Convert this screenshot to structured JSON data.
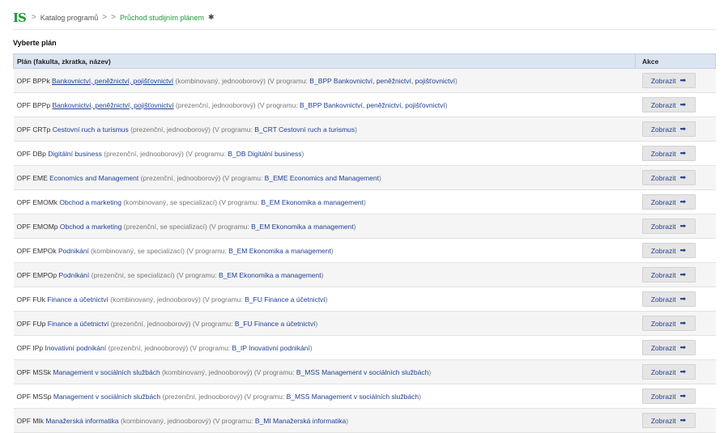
{
  "breadcrumb": {
    "logo": "IS",
    "sep": ">",
    "katalog": "Katalog programů",
    "current": "Průchod studijním plánem",
    "pin": "✱"
  },
  "heading": "Vyberte plán",
  "table": {
    "col_plan": "Plán (fakulta, zkratka, název)",
    "col_akce": "Akce",
    "button_label": "Zobrazit",
    "button_arrow": "➡",
    "rows": [
      {
        "code": "OPF BPPk",
        "name": "Bankovnictví, peněžnictví, pojišťovnictví",
        "underline": true,
        "meta": " (kombinovaný, jednooborový) (V programu: ",
        "prog": "B_BPP Bankovnictví, peněžnictví, pojišťovnictví",
        "end": ")"
      },
      {
        "code": "OPF BPPp",
        "name": "Bankovnictví, peněžnictví, pojišťovnictví",
        "underline": true,
        "meta": " (prezenční, jednooborový) (V programu: ",
        "prog": "B_BPP Bankovnictví, peněžnictví, pojišťovnictví",
        "end": ")"
      },
      {
        "code": "OPF CRTp",
        "name": "Cestovní ruch a turismus",
        "underline": false,
        "meta": " (prezenční, jednooborový) (V programu: ",
        "prog": "B_CRT Cestovní ruch a turismus",
        "end": ")"
      },
      {
        "code": "OPF DBp",
        "name": "Digitální business",
        "underline": false,
        "meta": " (prezenční, jednooborový) (V programu: ",
        "prog": "B_DB Digitální business",
        "end": ")"
      },
      {
        "code": "OPF EME",
        "name": "Economics and Management",
        "underline": false,
        "meta": " (prezenční, jednooborový) (V programu: ",
        "prog": "B_EME Economics and Management",
        "end": ")"
      },
      {
        "code": "OPF EMOMk",
        "name": "Obchod a marketing",
        "underline": false,
        "meta": " (kombinovaný, se specializací) (V programu: ",
        "prog": "B_EM Ekonomika a management",
        "end": ")"
      },
      {
        "code": "OPF EMOMp",
        "name": "Obchod a marketing",
        "underline": false,
        "meta": " (prezenční, se specializací) (V programu: ",
        "prog": "B_EM Ekonomika a management",
        "end": ")"
      },
      {
        "code": "OPF EMPOk",
        "name": "Podnikání",
        "underline": false,
        "meta": " (kombinovaný, se specializací) (V programu: ",
        "prog": "B_EM Ekonomika a management",
        "end": ")"
      },
      {
        "code": "OPF EMPOp",
        "name": "Podnikání",
        "underline": false,
        "meta": " (prezenční, se specializací) (V programu: ",
        "prog": "B_EM Ekonomika a management",
        "end": ")"
      },
      {
        "code": "OPF FUk",
        "name": "Finance a účetnictví",
        "underline": false,
        "meta": " (kombinovaný, jednooborový) (V programu: ",
        "prog": "B_FU Finance a účetnictví",
        "end": ")"
      },
      {
        "code": "OPF FUp",
        "name": "Finance a účetnictví",
        "underline": false,
        "meta": " (prezenční, jednooborový) (V programu: ",
        "prog": "B_FU Finance a účetnictví",
        "end": ")"
      },
      {
        "code": "OPF IPp",
        "name": "Inovativní podnikání",
        "underline": false,
        "meta": " (prezenční, jednooborový) (V programu: ",
        "prog": "B_IP Inovativní podnikání",
        "end": ")"
      },
      {
        "code": "OPF MSSk",
        "name": "Management v sociálních službách",
        "underline": false,
        "meta": " (kombinovaný, jednooborový) (V programu: ",
        "prog": "B_MSS Management v sociálních službách",
        "end": ")"
      },
      {
        "code": "OPF MSSp",
        "name": "Management v sociálních službách",
        "underline": false,
        "meta": " (prezenční, jednooborový) (V programu: ",
        "prog": "B_MSS Management v sociálních službách",
        "end": ")"
      },
      {
        "code": "OPF MIk",
        "name": "Manažerská informatika",
        "underline": false,
        "meta": " (kombinovaný, jednooborový) (V programu: ",
        "prog": "B_MI Manažerská informatika",
        "end": ")"
      }
    ]
  }
}
